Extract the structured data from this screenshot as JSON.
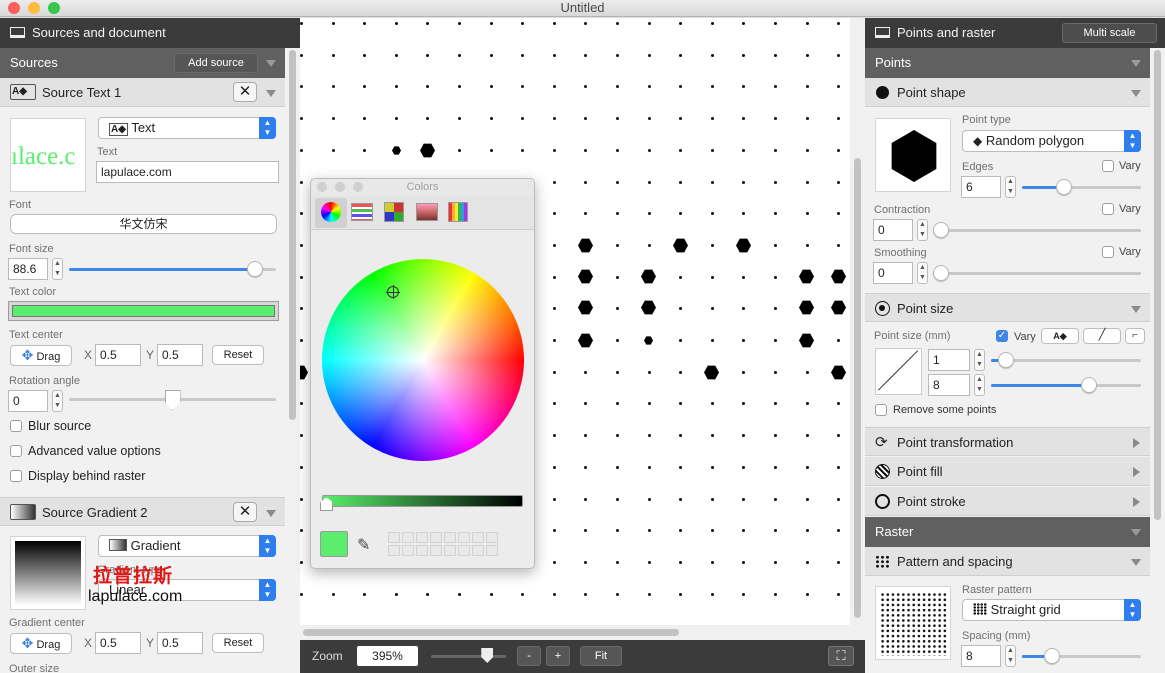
{
  "window": {
    "title": "Untitled"
  },
  "left": {
    "header": "Sources and document",
    "sources_label": "Sources",
    "add_source": "Add source",
    "source1": {
      "title": "Source Text 1",
      "preview_text": "ılace.c",
      "type_value": "Text",
      "text_label": "Text",
      "text_value": "lapulace.com",
      "font_label": "Font",
      "font_value": "华文仿宋",
      "font_size_label": "Font size",
      "font_size_value": "88.6",
      "font_size_level": 0.9,
      "text_color_label": "Text color",
      "text_color": "#5aee6c",
      "text_center_label": "Text center",
      "drag": "Drag",
      "x_label": "X",
      "x_value": "0.5",
      "y_label": "Y",
      "y_value": "0.5",
      "reset": "Reset",
      "rotation_label": "Rotation angle",
      "rotation_value": "0",
      "rotation_level": 0.5,
      "blur": "Blur source",
      "advanced": "Advanced value options",
      "behind": "Display behind raster"
    },
    "source2": {
      "title": "Source Gradient 2",
      "type_value": "Gradient",
      "gradient_type_label": "Gradient type",
      "gradient_type_value": "Linear",
      "watermark_cn": "拉普拉斯",
      "watermark_en": "lapulace.com",
      "center_label": "Gradient center",
      "drag": "Drag",
      "x_label": "X",
      "x_value": "0.5",
      "y_label": "Y",
      "y_value": "0.5",
      "reset": "Reset",
      "outer_label": "Outer size"
    }
  },
  "colors_panel": {
    "title": "Colors",
    "current_color": "#5aee6c",
    "swatch_count": 16
  },
  "canvas": {
    "zoom_label": "Zoom",
    "zoom_value": "395%",
    "zoom_level": 0.75,
    "minus": "-",
    "plus": "+",
    "fit": "Fit"
  },
  "right": {
    "header": "Points and raster",
    "multi_scale": "Multi scale",
    "points_label": "Points",
    "point_shape": {
      "title": "Point shape",
      "type_label": "Point type",
      "type_value": "Random polygon",
      "edges_label": "Edges",
      "edges_value": "6",
      "edges_level": 0.35,
      "contraction_label": "Contraction",
      "contraction_value": "0",
      "smoothing_label": "Smoothing",
      "smoothing_value": "0",
      "vary": "Vary"
    },
    "point_size": {
      "title": "Point size",
      "size_label": "Point size (mm)",
      "vary": "Vary",
      "vary_checked": true,
      "min_value": "1",
      "min_level": 0.1,
      "max_value": "8",
      "max_level": 0.65,
      "remove_some": "Remove some points"
    },
    "point_transformation": "Point transformation",
    "point_fill": "Point fill",
    "point_stroke": "Point stroke",
    "raster_label": "Raster",
    "pattern": {
      "title": "Pattern and spacing",
      "raster_pattern_label": "Raster pattern",
      "raster_pattern_value": "Straight grid",
      "spacing_label": "Spacing (mm)",
      "spacing_value": "8",
      "spacing_level": 0.25
    }
  }
}
